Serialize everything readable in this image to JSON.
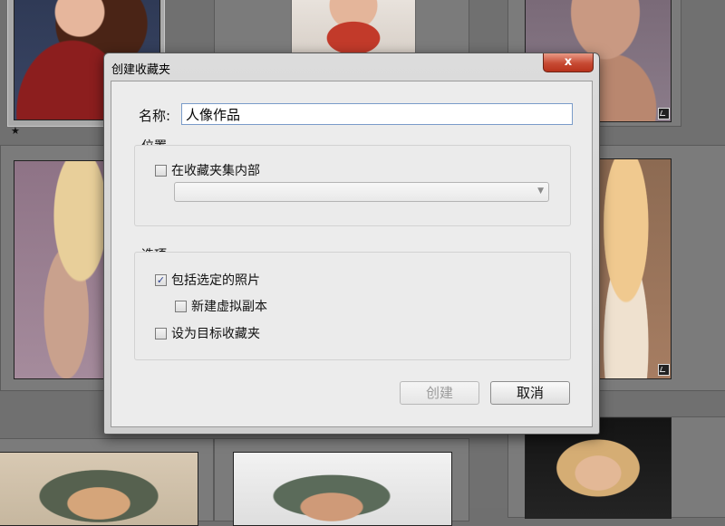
{
  "dialog": {
    "title": "创建收藏夹",
    "close_glyph": "x",
    "name_label": "名称:",
    "name_value": "人像作品",
    "location": {
      "title": "位置",
      "inside_set_label": "在收藏夹集内部",
      "inside_set_checked": false,
      "set_select_value": ""
    },
    "options": {
      "title": "选项",
      "include_selected_label": "包括选定的照片",
      "include_selected_checked": true,
      "new_virtual_copies_label": "新建虚拟副本",
      "new_virtual_copies_checked": false,
      "set_as_target_label": "设为目标收藏夹",
      "set_as_target_checked": false
    },
    "create_label": "创建",
    "cancel_label": "取消"
  },
  "grid": {
    "star_glyph": "★"
  },
  "colors": {
    "close_button": "#c74a33",
    "input_border": "#7a9bc9",
    "checkmark": "#2a3f8f"
  }
}
